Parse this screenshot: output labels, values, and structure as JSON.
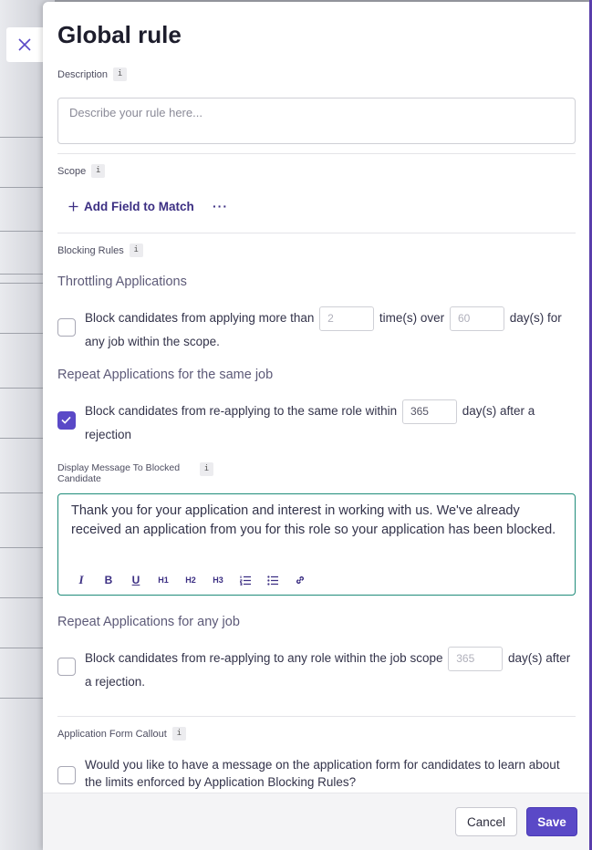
{
  "panel": {
    "title": "Global rule",
    "description": {
      "label": "Description",
      "placeholder": "Describe your rule here..."
    },
    "scope": {
      "label": "Scope",
      "add_field_label": "Add Field to Match",
      "more_label": "···"
    },
    "blocking_rules": {
      "label": "Blocking Rules",
      "throttling": {
        "title": "Throttling Applications",
        "checked": false,
        "text_before": "Block candidates from applying more than",
        "count_placeholder": "2",
        "text_middle": "time(s) over",
        "days_placeholder": "60",
        "text_after_line1": "day(s) for",
        "text_after_line2": "any job within the scope."
      },
      "same_job": {
        "title": "Repeat Applications for the same job",
        "checked": true,
        "text_before": "Block candidates from re-applying to the same role within",
        "days_value": "365",
        "text_after_line1": "day(s) after a",
        "text_after_line2": "rejection"
      },
      "display_message": {
        "label_line1": "Display Message To Blocked",
        "label_line2": "Candidate",
        "text": "Thank you for your application and interest in working with us. We've already received an application from you for this role so your application has been blocked.",
        "toolbar": [
          "I",
          "B",
          "U",
          "H1",
          "H2",
          "H3",
          "ordered-list",
          "bullet-list",
          "link"
        ]
      },
      "any_job": {
        "title": "Repeat Applications for any job",
        "checked": false,
        "text_before": "Block candidates from re-applying to any role within the job scope",
        "days_placeholder": "365",
        "text_after_line1": "day(s) after",
        "text_after_line2": "a rejection."
      }
    },
    "callout": {
      "label": "Application Form Callout",
      "checked": false,
      "text_line1": "Would you like to have a message on the application form for candidates to learn about",
      "text_line2": "the limits enforced by Application Blocking Rules?"
    },
    "footer": {
      "cancel_label": "Cancel",
      "save_label": "Save"
    }
  },
  "info_icon_glyph": "i",
  "colors": {
    "accent": "#5a49c7",
    "link": "#3c2f83",
    "focus_border": "#1f8c7a",
    "right_edge": "#5b3fae"
  }
}
